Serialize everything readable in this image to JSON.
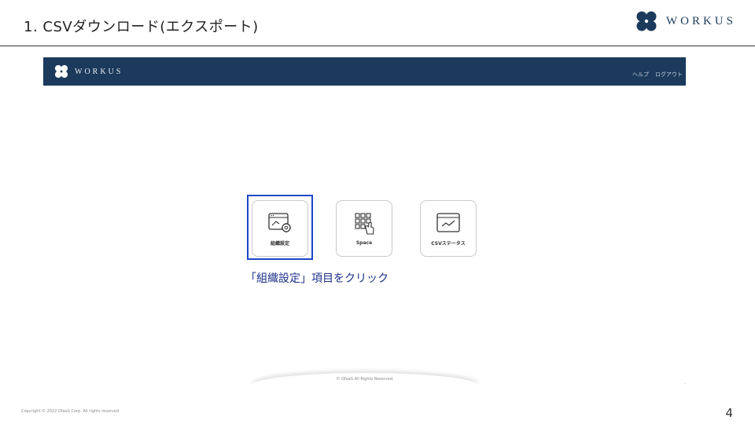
{
  "slide": {
    "title": "1. CSVダウンロード(エクスポート)",
    "brand": "WORKUS",
    "page_number": "4",
    "copyright": "Copyright © 2022 OfaaS Corp. All rights reserved."
  },
  "app": {
    "logo": "WORKUS",
    "nav": {
      "help": "ヘルプ",
      "logout": "ログアウト"
    },
    "tiles": [
      {
        "label": "組織設定",
        "icon": "org-settings-icon"
      },
      {
        "label": "Space",
        "icon": "space-grid-icon"
      },
      {
        "label": "CSVステータス",
        "icon": "csv-chart-icon"
      }
    ],
    "footer": "© OfaaS All Rights Reserved.",
    "footer_dot": "."
  },
  "callout": {
    "text": "「組織設定」項目をクリック"
  },
  "colors": {
    "navy": "#1b3a5c",
    "highlight": "#1a47c4",
    "callout_text": "#1b2f8a"
  }
}
